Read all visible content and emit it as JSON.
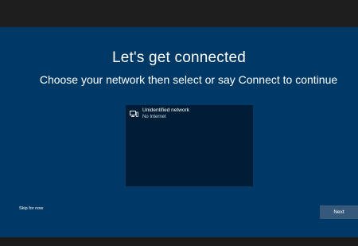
{
  "window": {
    "background": "#003966",
    "chrome_color": "#1e1e1e"
  },
  "header": {
    "title": "Let's get connected",
    "subtitle": "Choose your network then select or say Connect to continue"
  },
  "networks": [
    {
      "name": "Unidentified network",
      "status": "No Internet",
      "icon": "wired-network-icon"
    }
  ],
  "footer": {
    "skip_label": "Skip for now",
    "next_label": "Next",
    "next_color": "#35587b"
  }
}
